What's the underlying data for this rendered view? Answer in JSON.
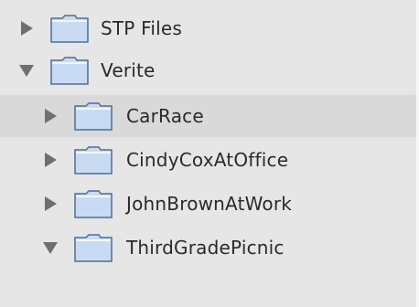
{
  "tree": {
    "items": [
      {
        "label": "STP Files",
        "expanded": false,
        "level": 0,
        "icon": "folder-icon"
      },
      {
        "label": "Verite",
        "expanded": true,
        "level": 0,
        "icon": "folder-icon"
      },
      {
        "label": "CarRace",
        "expanded": false,
        "level": 1,
        "selected": true,
        "icon": "folder-icon"
      },
      {
        "label": "CindyCoxAtOffice",
        "expanded": false,
        "level": 1,
        "icon": "folder-icon"
      },
      {
        "label": "JohnBrownAtWork",
        "expanded": false,
        "level": 1,
        "icon": "folder-icon"
      },
      {
        "label": "ThirdGradePicnic",
        "expanded": true,
        "level": 1,
        "icon": "folder-icon"
      }
    ]
  },
  "colors": {
    "background": "#e6e6e6",
    "selection": "#d9d9d9",
    "folder_fill": "#c9dbf3",
    "folder_stroke": "#4a6e9a",
    "disclosure": "#6f6f6f",
    "text": "#2a2a2a"
  }
}
